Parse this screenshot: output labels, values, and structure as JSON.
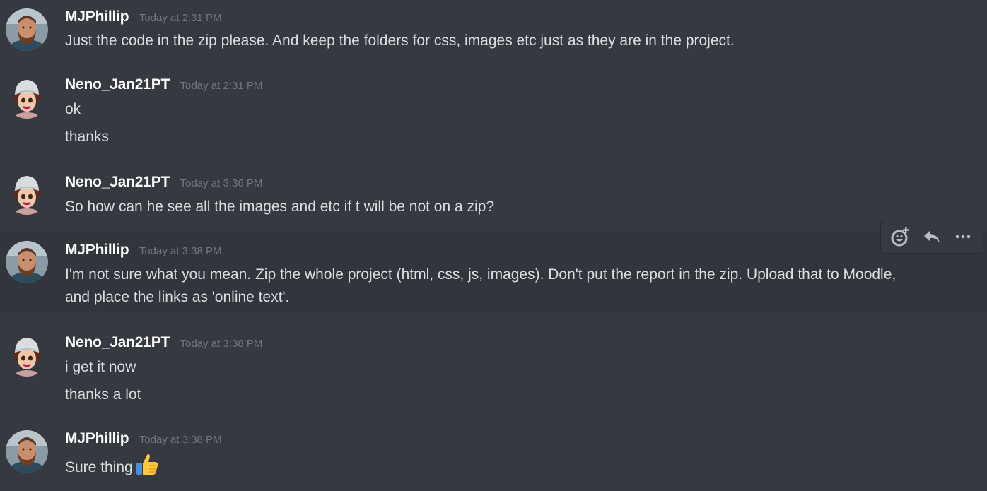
{
  "colors": {
    "background": "#36393f",
    "hover_background": "#32353b",
    "username": "#ffffff",
    "timestamp": "#72767d",
    "message_text": "#dcddde"
  },
  "messages": [
    {
      "author": "MJPhillip",
      "timestamp": "Today at 2:31 PM",
      "avatar": "bearded-man-avatar",
      "lines": [
        "Just the code in the zip please. And keep the folders for css, images etc just as they are in the project."
      ]
    },
    {
      "author": "Neno_Jan21PT",
      "timestamp": "Today at 2:31 PM",
      "avatar": "cartoon-woman-beanie-avatar",
      "lines": [
        "ok",
        "thanks"
      ]
    },
    {
      "author": "Neno_Jan21PT",
      "timestamp": "Today at 3:36 PM",
      "avatar": "cartoon-woman-beanie-avatar",
      "lines": [
        "So how can he see all the images and etc if t will be not on a zip?"
      ]
    },
    {
      "author": "MJPhillip",
      "timestamp": "Today at 3:38 PM",
      "avatar": "bearded-man-avatar",
      "lines": [
        "I'm not sure what you mean. Zip the whole project (html, css, js, images). Don't put the report in the zip. Upload that to Moodle, and place the links as 'online text'."
      ]
    },
    {
      "author": "Neno_Jan21PT",
      "timestamp": "Today at 3:38 PM",
      "avatar": "cartoon-woman-beanie-avatar",
      "lines": [
        "i get it now",
        "thanks a lot"
      ]
    },
    {
      "author": "MJPhillip",
      "timestamp": "Today at 3:38 PM",
      "avatar": "bearded-man-avatar",
      "lines": [
        "Sure thing"
      ],
      "emoji": "thumbs-up-emoji"
    }
  ],
  "action_bar": {
    "buttons": [
      "add-reaction-icon",
      "reply-icon",
      "more-options-icon"
    ]
  }
}
